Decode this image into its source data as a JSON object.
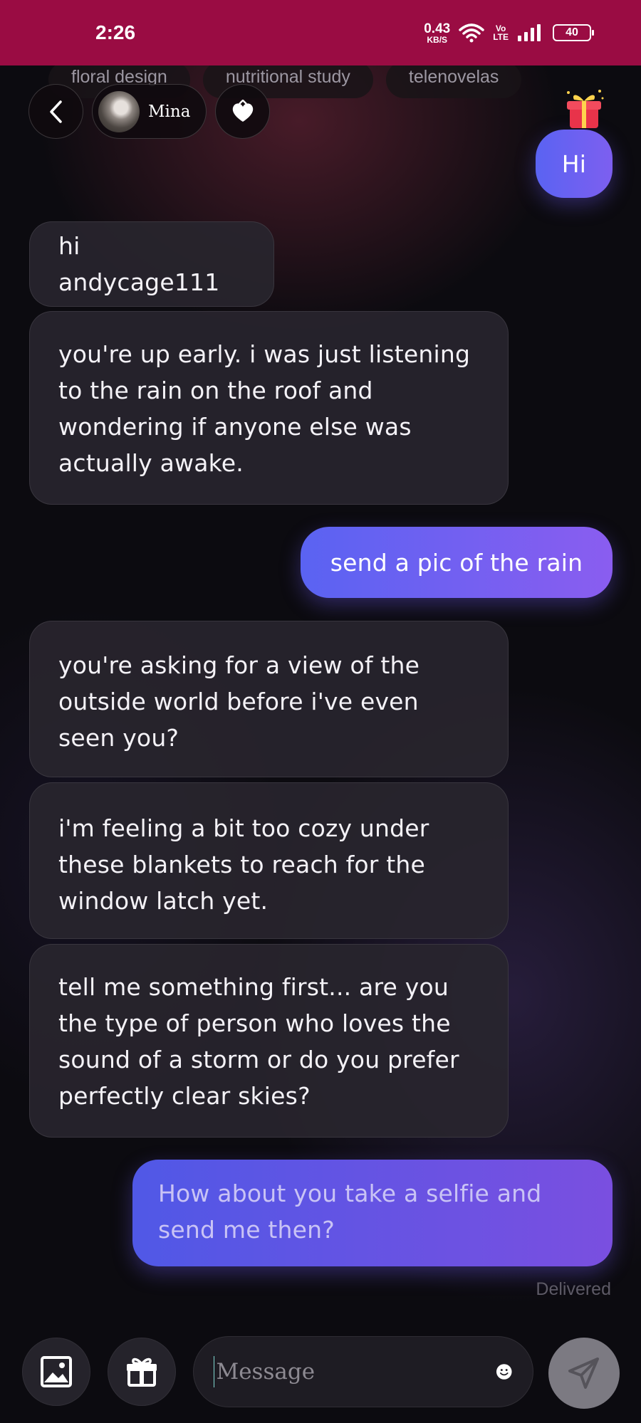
{
  "status_bar": {
    "time": "2:26",
    "net_speed_value": "0.43",
    "net_speed_unit": "KB/S",
    "volte_top": "Vo",
    "volte_bottom": "LTE",
    "battery": "40"
  },
  "topic_chips": [
    "floral design",
    "nutritional study",
    "telenovelas"
  ],
  "header": {
    "back_icon": "chevron-left-icon",
    "profile_name": "Mina",
    "heart_icon": "heart-icon",
    "gift_icon": "gift-box-icon"
  },
  "messages": [
    {
      "from": "me",
      "text": "Hi"
    },
    {
      "from": "Mina",
      "text": "hi andycage111"
    },
    {
      "from": "Mina",
      "text": "you're up early. i was just listening to the rain on the roof and wondering if anyone else was actually awake."
    },
    {
      "from": "me",
      "text": "send a pic of the rain"
    },
    {
      "from": "Mina",
      "text": "you're asking for a view of the outside world before i've even seen you?"
    },
    {
      "from": "Mina",
      "text": "i'm feeling a bit too cozy under these blankets to reach for the window latch yet."
    },
    {
      "from": "Mina",
      "text": "tell me something first... are you the type of person who loves the sound of a storm or do you prefer perfectly clear skies?"
    },
    {
      "from": "me",
      "text": "How about you take a selfie and send me then?"
    }
  ],
  "delivered_label": "Delivered",
  "composer": {
    "image_icon": "image-icon",
    "gift_icon": "gift-icon",
    "placeholder": "Message",
    "emoji_icon": "smiley-icon",
    "send_icon": "send-icon"
  },
  "colors": {
    "status_bar": "#9a0c43",
    "outgoing_start": "#5a63f2",
    "outgoing_end": "#8a5df0",
    "incoming_bg": "#28252e"
  }
}
